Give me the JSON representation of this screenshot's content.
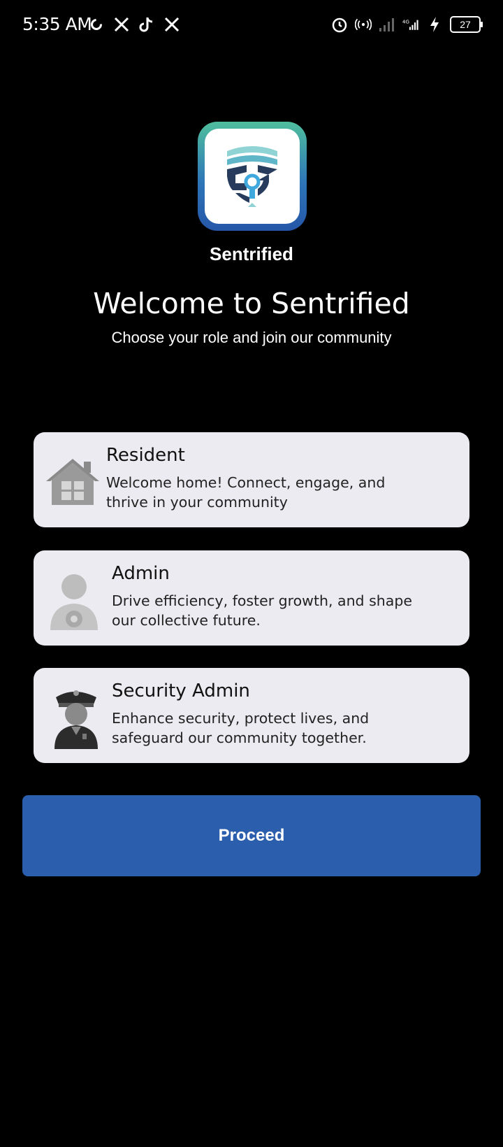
{
  "status_bar": {
    "time": "5:35 AM",
    "left_icons": [
      "sync-icon",
      "x-icon",
      "tiktok-icon",
      "x-icon"
    ],
    "right_icons": [
      "alarm-icon",
      "hotspot-icon",
      "signal-icon",
      "4g-signal-icon",
      "charging-icon"
    ],
    "battery": "27"
  },
  "app": {
    "name": "Sentrified",
    "logo_colors": [
      "#4fbf9d",
      "#2e76b7",
      "#2556a8"
    ]
  },
  "header": {
    "title": "Welcome to Sentrified",
    "subtitle": "Choose your role and join our community"
  },
  "roles": [
    {
      "title": "Resident",
      "description": "Welcome home! Connect, engage, and thrive in your community",
      "icon": "house-icon"
    },
    {
      "title": "Admin",
      "description": "Drive efficiency, foster growth, and shape our collective future.",
      "icon": "admin-user-icon"
    },
    {
      "title": "Security Admin",
      "description": "Enhance security, protect lives, and safeguard our community together.",
      "icon": "security-guard-icon"
    }
  ],
  "actions": {
    "proceed_label": "Proceed",
    "proceed_color": "#2b5ead"
  }
}
